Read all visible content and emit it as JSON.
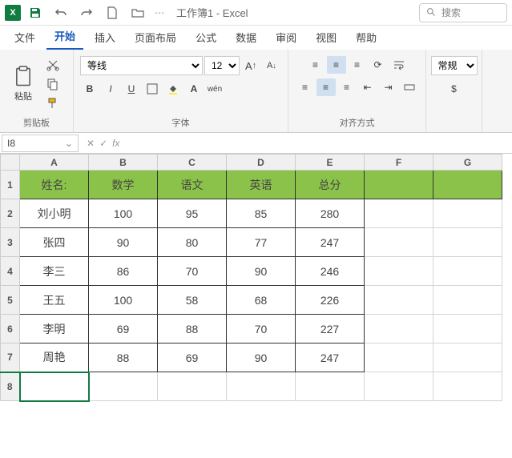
{
  "app": {
    "logo": "X",
    "title": "工作簿1 - Excel",
    "search_placeholder": "搜索"
  },
  "tabs": {
    "file": "文件",
    "home": "开始",
    "insert": "插入",
    "layout": "页面布局",
    "formula": "公式",
    "data": "数据",
    "review": "审阅",
    "view": "视图",
    "help": "帮助"
  },
  "ribbon": {
    "clipboard": {
      "paste": "粘贴",
      "label": "剪贴板"
    },
    "font": {
      "name": "等线",
      "size": "12",
      "label": "字体"
    },
    "align": {
      "label": "对齐方式"
    },
    "number": {
      "general": "常规"
    }
  },
  "namebox": "I8",
  "chart_data": {
    "type": "table",
    "columns": [
      "姓名:",
      "数学",
      "语文",
      "英语",
      "总分"
    ],
    "rows": [
      [
        "刘小明",
        "100",
        "95",
        "85",
        "280"
      ],
      [
        "张四",
        "90",
        "80",
        "77",
        "247"
      ],
      [
        "李三",
        "86",
        "70",
        "90",
        "246"
      ],
      [
        "王五",
        "100",
        "58",
        "68",
        "226"
      ],
      [
        "李明",
        "69",
        "88",
        "70",
        "227"
      ],
      [
        "周艳",
        "88",
        "69",
        "90",
        "247"
      ]
    ]
  },
  "cols": [
    "A",
    "B",
    "C",
    "D",
    "E",
    "F",
    "G"
  ]
}
